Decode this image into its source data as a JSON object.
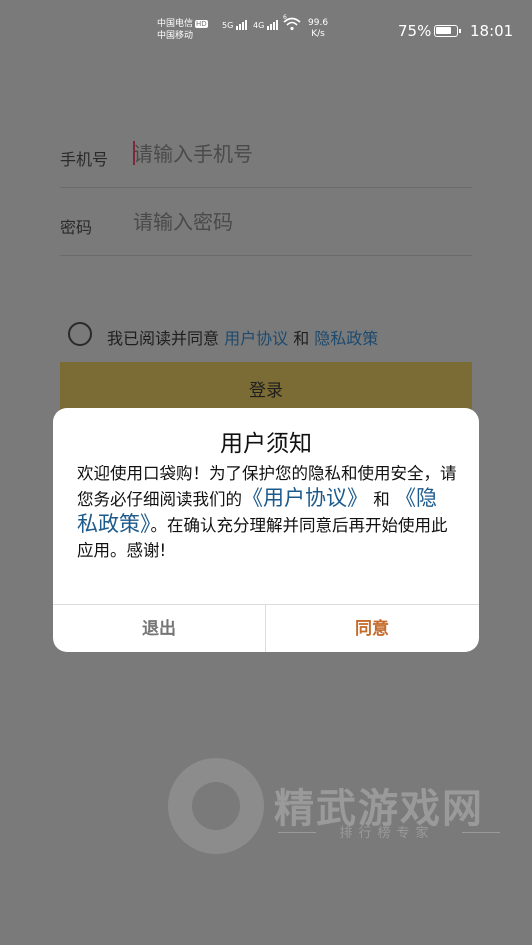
{
  "status_bar": {
    "carrier1": "中国电信",
    "hd_badge": "HD",
    "carrier2": "中国移动",
    "sig1_tech": "5G",
    "sig2_tech": "4G",
    "wifi_tech": "6",
    "speed_value": "99.6",
    "speed_unit": "K/s",
    "battery_percent": "75%",
    "battery_level": 0.75,
    "time": "18:01"
  },
  "login": {
    "phone_label": "手机号",
    "phone_placeholder": "请输入手机号",
    "password_label": "密码",
    "password_placeholder": "请输入密码",
    "agree_prefix": "我已阅读并同意 ",
    "user_agreement_link": "用户协议",
    "agree_and": " 和 ",
    "privacy_link": "隐私政策",
    "login_button": "登录"
  },
  "watermark": {
    "title": "精武游戏网",
    "subtitle": "排行榜专家"
  },
  "dialog": {
    "title": "用户须知",
    "body_part1": "欢迎使用口袋购！为了保护您的隐私和使用安全，请您务必仔细阅读我们的",
    "link_user_agreement": "《用户协议》",
    "body_and": "和",
    "link_privacy": "《隐私政策》",
    "body_part2": "。在确认充分理解并同意后再开始使用此应用。感谢!",
    "exit_button": "退出",
    "agree_button": "同意"
  },
  "colors": {
    "overlay_bg": "#7a7a7a",
    "login_button_bg": "#7b6b35",
    "link_blue": "#1d5a8c",
    "agree_orange": "#c46a2a"
  }
}
